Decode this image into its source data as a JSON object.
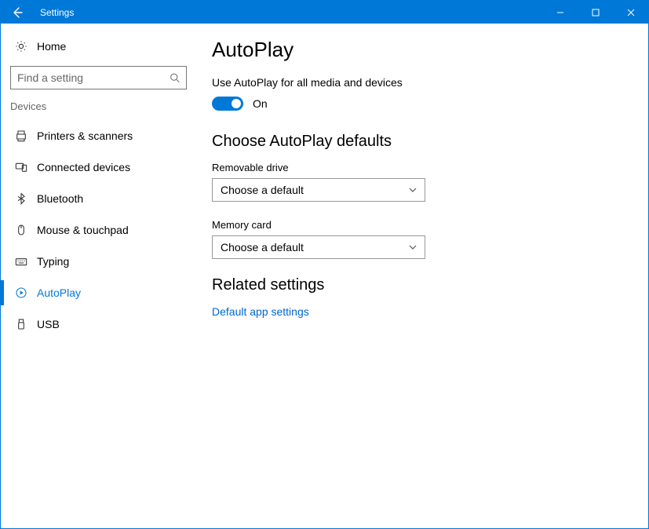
{
  "titlebar": {
    "title": "Settings"
  },
  "sidebar": {
    "home_label": "Home",
    "search_placeholder": "Find a setting",
    "section_label": "Devices",
    "items": [
      {
        "label": "Printers & scanners"
      },
      {
        "label": "Connected devices"
      },
      {
        "label": "Bluetooth"
      },
      {
        "label": "Mouse & touchpad"
      },
      {
        "label": "Typing"
      },
      {
        "label": "AutoPlay"
      },
      {
        "label": "USB"
      }
    ]
  },
  "main": {
    "title": "AutoPlay",
    "toggle_label": "Use AutoPlay for all media and devices",
    "toggle_state": "On",
    "defaults_heading": "Choose AutoPlay defaults",
    "removable_label": "Removable drive",
    "removable_value": "Choose a default",
    "memory_label": "Memory card",
    "memory_value": "Choose a default",
    "related_heading": "Related settings",
    "related_link": "Default app settings"
  }
}
